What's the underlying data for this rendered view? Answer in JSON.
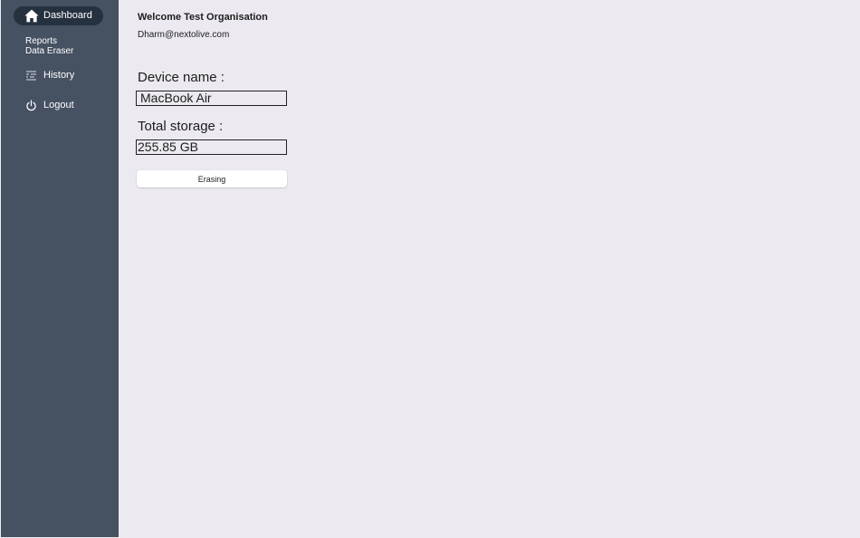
{
  "sidebar": {
    "active_item": {
      "label": "Dashboard",
      "icon": "home-icon"
    },
    "sub_links": [
      "Reports",
      "Data Eraser"
    ],
    "items": [
      {
        "label": "History",
        "icon": "history-icon"
      },
      {
        "label": "Logout",
        "icon": "power-icon"
      }
    ]
  },
  "main": {
    "welcome": "Welcome Test Organisation",
    "email": "Dharm@nextolive.com",
    "device_name": {
      "label": "Device name :",
      "value": "MacBook Air"
    },
    "total_storage": {
      "label": "Total storage :",
      "value": "255.85 GB"
    },
    "action_button": "Erasing"
  },
  "colors": {
    "sidebar_bg": "#465162",
    "active_pill": "#263140",
    "content_bg": "#ECEAF0"
  }
}
